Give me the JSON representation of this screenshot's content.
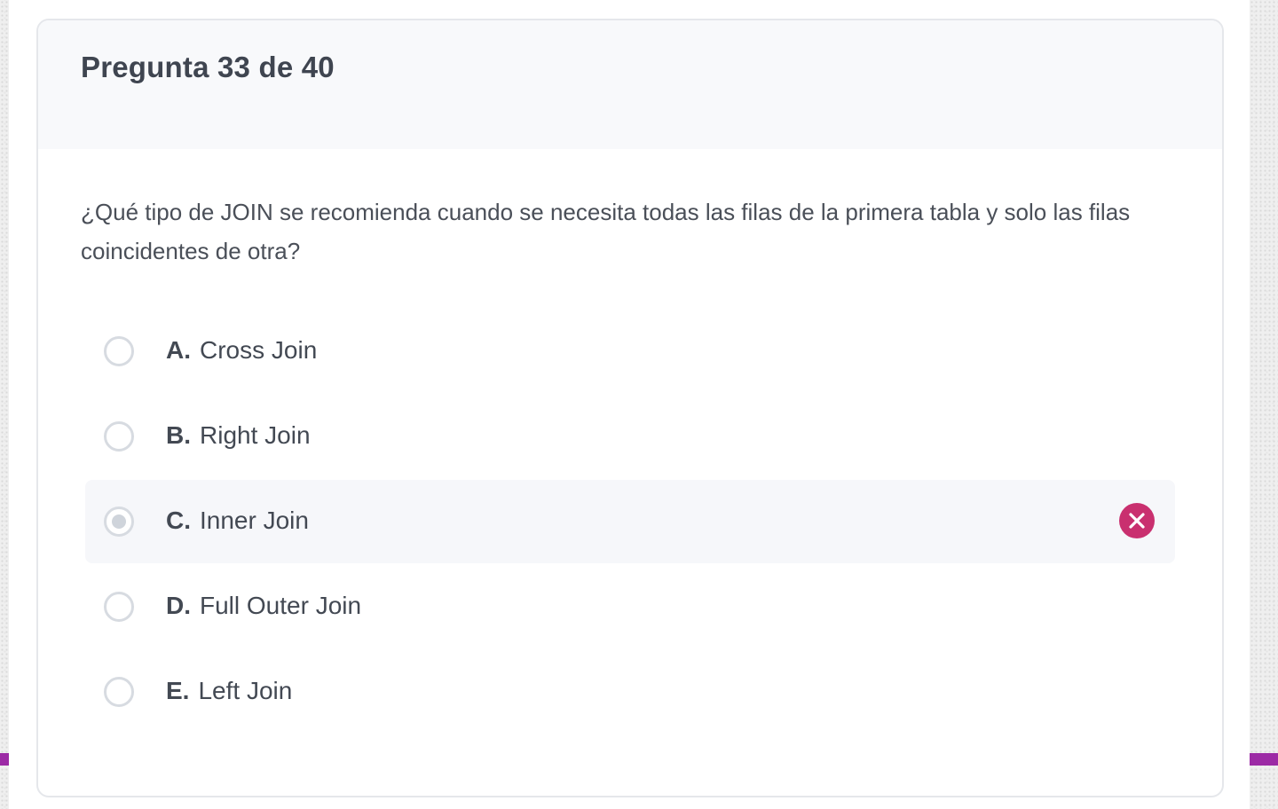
{
  "quiz": {
    "progress_label": "Pregunta 33 de 40",
    "question_text": "¿Qué tipo de JOIN se recomienda cuando se necesita todas las filas de la primera tabla y solo las filas coincidentes de otra?",
    "options": [
      {
        "letter": "A.",
        "label": "Cross Join",
        "selected": false
      },
      {
        "letter": "B.",
        "label": "Right Join",
        "selected": false
      },
      {
        "letter": "C.",
        "label": "Inner Join",
        "selected": true,
        "status": "incorrect",
        "status_icon": "close-circle-icon"
      },
      {
        "letter": "D.",
        "label": "Full Outer Join",
        "selected": false
      },
      {
        "letter": "E.",
        "label": "Left Join",
        "selected": false
      }
    ]
  },
  "colors": {
    "incorrect": "#c9306f",
    "accent": "#9c2aa5",
    "header_bg": "#f8f9fb",
    "selected_bg": "#f6f7fa"
  }
}
